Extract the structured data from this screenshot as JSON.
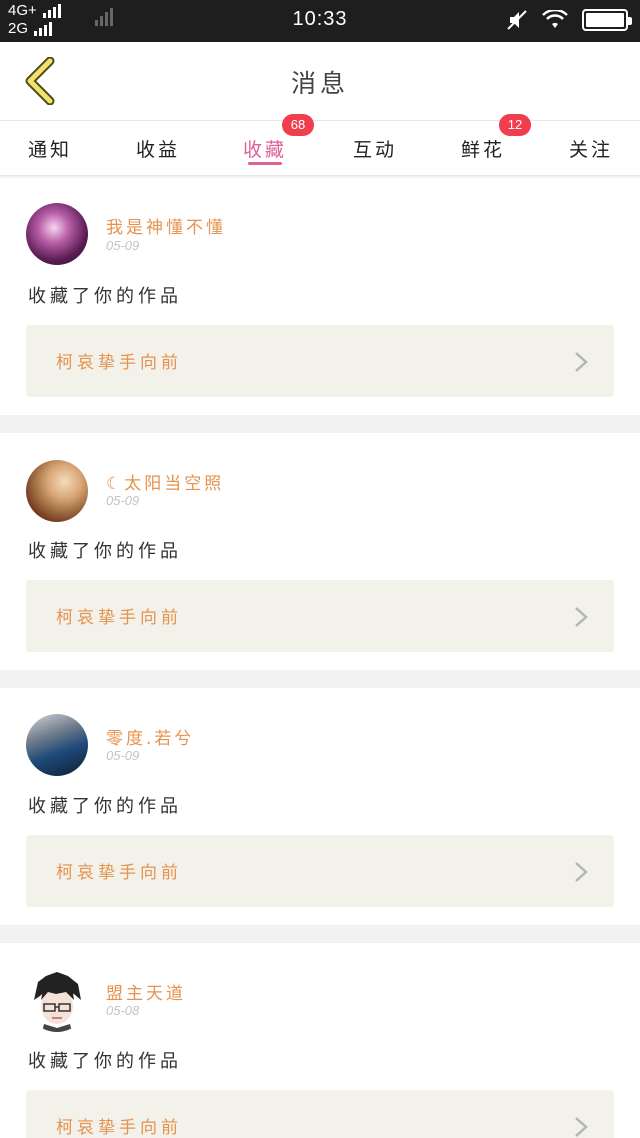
{
  "status_bar": {
    "network_top": "4G+",
    "network_bottom": "2G",
    "time": "10:33"
  },
  "header": {
    "title": "消息",
    "back_icon": "chevron-left-icon"
  },
  "tabs": [
    {
      "label": "通知",
      "badge": ""
    },
    {
      "label": "收益",
      "badge": ""
    },
    {
      "label": "收藏",
      "badge": "68",
      "active": true
    },
    {
      "label": "互动",
      "badge": ""
    },
    {
      "label": "鲜花",
      "badge": "12"
    },
    {
      "label": "关注",
      "badge": ""
    }
  ],
  "notifications": [
    {
      "user": "我是神懂不懂",
      "date": "05-09",
      "action": "收藏了你的作品",
      "work_title": "柯哀挚手向前",
      "avatar": "purple-blur"
    },
    {
      "user": "☾太阳当空照",
      "date": "05-09",
      "action": "收藏了你的作品",
      "work_title": "柯哀挚手向前",
      "avatar": "girl-photo"
    },
    {
      "user": "零度.若兮",
      "date": "05-09",
      "action": "收藏了你的作品",
      "work_title": "柯哀挚手向前",
      "avatar": "blue-car"
    },
    {
      "user": "盟主天道",
      "date": "05-08",
      "action": "收藏了你的作品",
      "work_title": "柯哀挚手向前",
      "avatar": "anime-boy"
    }
  ],
  "colors": {
    "accent_pink": "#e0609a",
    "badge_red": "#f03e4f",
    "name_orange": "#e6934f",
    "back_yellow": "#f3e26a"
  }
}
